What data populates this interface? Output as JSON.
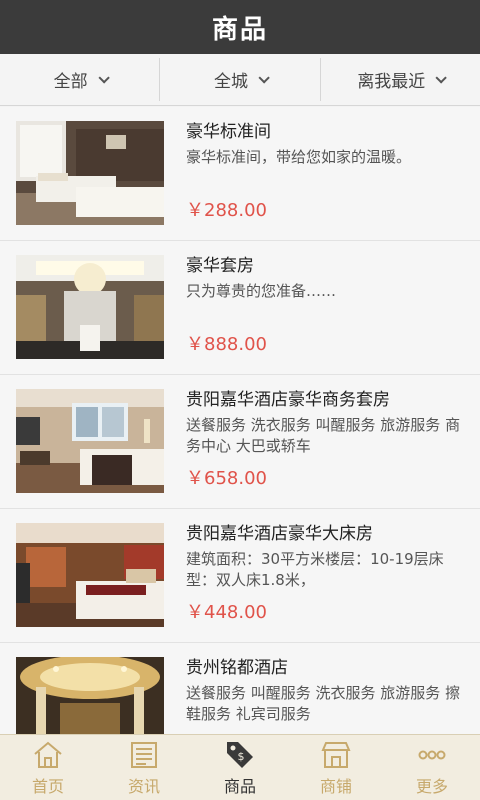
{
  "header": {
    "title": "商品"
  },
  "filters": [
    {
      "label": "全部"
    },
    {
      "label": "全城"
    },
    {
      "label": "离我最近"
    }
  ],
  "products": [
    {
      "name": "豪华标准间",
      "desc": "豪华标准间，带给您如家的温暖。",
      "price": "￥288.00"
    },
    {
      "name": "豪华套房",
      "desc": "只为尊贵的您准备……",
      "price": "￥888.00"
    },
    {
      "name": "贵阳嘉华酒店豪华商务套房",
      "desc": "送餐服务 洗衣服务 叫醒服务 旅游服务 商务中心 大巴或轿车",
      "price": "￥658.00"
    },
    {
      "name": "贵阳嘉华酒店豪华大床房",
      "desc": "建筑面积：30平方米楼层：10-19层床型：双人床1.8米，",
      "price": "￥448.00"
    },
    {
      "name": "贵州铭都酒店",
      "desc": "送餐服务 叫醒服务 洗衣服务 旅游服务 擦鞋服务 礼宾司服务",
      "price": ""
    }
  ],
  "tabs": [
    {
      "label": "首页",
      "icon": "home-icon"
    },
    {
      "label": "资讯",
      "icon": "news-icon"
    },
    {
      "label": "商品",
      "icon": "tag-icon",
      "active": true
    },
    {
      "label": "商铺",
      "icon": "store-icon"
    },
    {
      "label": "更多",
      "icon": "more-icon"
    }
  ],
  "colors": {
    "header": "#3b3b3b",
    "price": "#e0534a",
    "tab_inactive": "#c7a96c",
    "tab_bar": "#f2ede0"
  }
}
